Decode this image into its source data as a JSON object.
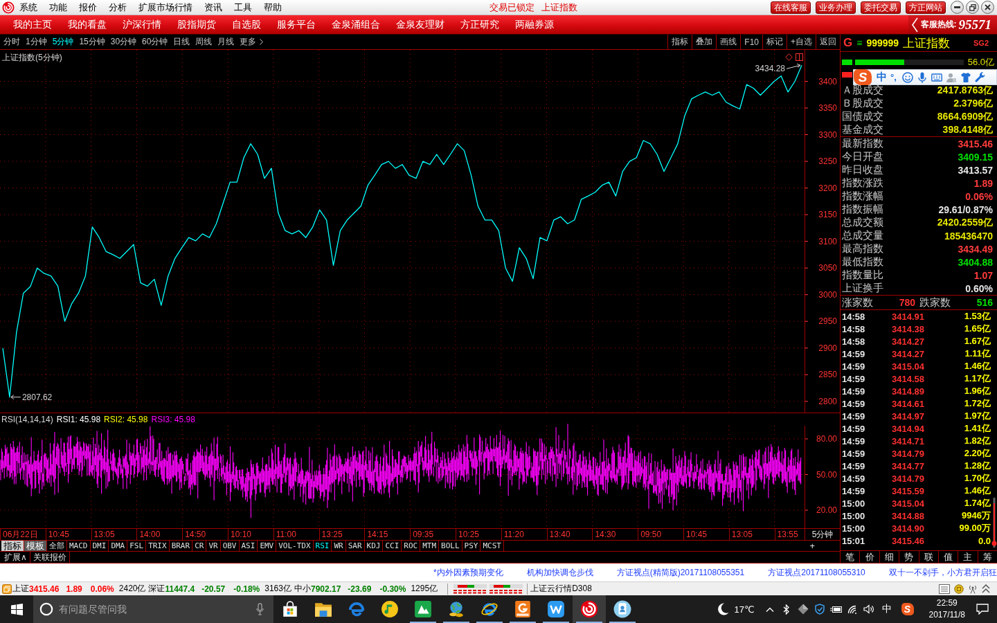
{
  "title_bar": {
    "menu": [
      "系统",
      "功能",
      "报价",
      "分析",
      "扩展市场行情",
      "资讯",
      "工具",
      "帮助"
    ],
    "lock_status": "交易已锁定",
    "current_security": "上证指数",
    "buttons": [
      "在线客服",
      "业务办理",
      "委托交易",
      "方正网站"
    ]
  },
  "nav_bar": {
    "items": [
      "我的主页",
      "我的看盘",
      "沪深行情",
      "股指期货",
      "自选股",
      "服务平台",
      "金泉涌组合",
      "金泉友理财",
      "方正研究",
      "两融券源"
    ],
    "hotline_label": "客服热线:",
    "hotline_number": "95571"
  },
  "chart_toolbar": {
    "periods": [
      {
        "label": "分时",
        "selected": false
      },
      {
        "label": "1分钟",
        "selected": false
      },
      {
        "label": "5分钟",
        "selected": true
      },
      {
        "label": "15分钟",
        "selected": false
      },
      {
        "label": "30分钟",
        "selected": false
      },
      {
        "label": "60分钟",
        "selected": false
      },
      {
        "label": "日线",
        "selected": false
      },
      {
        "label": "周线",
        "selected": false
      },
      {
        "label": "月线",
        "selected": false
      }
    ],
    "more": "更多",
    "tools": [
      "指标",
      "叠加",
      "画线",
      "F10",
      "标记",
      "+自选",
      "返回"
    ]
  },
  "price_chart": {
    "high_label": "3434.28",
    "low_label": "2807.62",
    "chart_data": {
      "type": "line",
      "title": "上证指数(5分钟)",
      "series": [
        {
          "color": "#00ffff",
          "values": [
            2900,
            2808,
            2930,
            3003,
            3015,
            3050,
            3040,
            3035,
            3016,
            2950,
            2983,
            3003,
            3035,
            3127,
            3107,
            3081,
            3075,
            3068,
            3081,
            3094,
            3022,
            3016,
            3029,
            2980,
            3035,
            3068,
            3088,
            3107,
            3101,
            3114,
            3107,
            3133,
            3172,
            3211,
            3211,
            3257,
            3283,
            3263,
            3218,
            3237,
            3153,
            3120,
            3114,
            3120,
            3107,
            3127,
            3159,
            3140,
            3055,
            3120,
            3140,
            3153,
            3166,
            3205,
            3224,
            3244,
            3250,
            3237,
            3244,
            3224,
            3218,
            3250,
            3244,
            3263,
            3244,
            3263,
            3283,
            3270,
            3224,
            3166,
            3140,
            3140,
            3120,
            3050,
            3025,
            3088,
            3068,
            3030,
            3107,
            3101,
            3140,
            3146,
            3133,
            3140,
            3179,
            3185,
            3192,
            3205,
            3211,
            3185,
            3231,
            3250,
            3257,
            3289,
            3283,
            3263,
            3231,
            3257,
            3283,
            3335,
            3367,
            3374,
            3380,
            3374,
            3380,
            3361,
            3354,
            3348,
            3394,
            3387,
            3374,
            3387,
            3400,
            3410,
            3380,
            3400,
            3430
          ]
        }
      ],
      "ylim": [
        2779,
        3459
      ],
      "yticks": [
        2800,
        2850,
        2900,
        2950,
        3000,
        3050,
        3100,
        3150,
        3200,
        3250,
        3300,
        3350,
        3400
      ],
      "grid": true
    }
  },
  "rsi_panel": {
    "title": "RSI(14,14,14)",
    "lines": [
      {
        "label": "RSI1: 45.98",
        "color": "#ffffff"
      },
      {
        "label": "RSI2: 45.98",
        "color": "#ffff00"
      },
      {
        "label": "RSI3: 45.98",
        "color": "#ff00ff"
      }
    ],
    "axis_labels": [
      "80.00",
      "50.00",
      "20.00"
    ]
  },
  "time_axis": {
    "labels": [
      "06月22日",
      "10:45",
      "13:05",
      "14:00",
      "14:50",
      "10:10",
      "11:00",
      "13:25",
      "14:15",
      "09:35",
      "10:25",
      "11:20",
      "13:40",
      "14:30",
      "09:50",
      "10:45",
      "13:05",
      "13:55"
    ],
    "period_label": "5分钟"
  },
  "indicator_bar": {
    "modes": [
      {
        "label": "指标",
        "selected": true
      },
      {
        "label": "模板",
        "selected": false
      }
    ],
    "indicators": [
      {
        "label": "全部",
        "selected": false
      },
      {
        "label": "MACD",
        "selected": false
      },
      {
        "label": "DMI",
        "selected": false
      },
      {
        "label": "DMA",
        "selected": false
      },
      {
        "label": "FSL",
        "selected": false
      },
      {
        "label": "TRIX",
        "selected": false
      },
      {
        "label": "BRAR",
        "selected": false
      },
      {
        "label": "CR",
        "selected": false
      },
      {
        "label": "VR",
        "selected": false
      },
      {
        "label": "OBV",
        "selected": false
      },
      {
        "label": "ASI",
        "selected": false
      },
      {
        "label": "EMV",
        "selected": false
      },
      {
        "label": "VOL-TDX",
        "selected": false
      },
      {
        "label": "RSI",
        "selected": true
      },
      {
        "label": "WR",
        "selected": false
      },
      {
        "label": "SAR",
        "selected": false
      },
      {
        "label": "KDJ",
        "selected": false
      },
      {
        "label": "CCI",
        "selected": false
      },
      {
        "label": "ROC",
        "selected": false
      },
      {
        "label": "MTM",
        "selected": false
      },
      {
        "label": "BOLL",
        "selected": false
      },
      {
        "label": "PSY",
        "selected": false
      },
      {
        "label": "MCST",
        "selected": false
      }
    ],
    "add_label": "+"
  },
  "extra_row": [
    "扩展∧",
    "关联报价"
  ],
  "quote_panel": {
    "flag": "G",
    "menu": "≡",
    "code": "999999",
    "name": "上证指数",
    "tag": "SG2",
    "volume_bars": [
      {
        "color": "#00e000",
        "level": 0.45,
        "reading": "56.0亿"
      },
      {
        "color": "#ff2020"
      }
    ],
    "turnover": [
      {
        "label": "Ａ股成交",
        "value": "2417.8763亿"
      },
      {
        "label": "Ｂ股成交",
        "value": "2.3796亿"
      },
      {
        "label": "国债成交",
        "value": "8664.6909亿"
      },
      {
        "label": "基金成交",
        "value": "398.4148亿"
      }
    ],
    "stats": [
      {
        "label": "最新指数",
        "value": "3415.46",
        "color": "#ff3c3c"
      },
      {
        "label": "今日开盘",
        "value": "3409.15",
        "color": "#00e000"
      },
      {
        "label": "昨日收盘",
        "value": "3413.57",
        "color": "#e8e8e8"
      },
      {
        "label": "指数涨跌",
        "value": "1.89",
        "color": "#ff3c3c"
      },
      {
        "label": "指数涨幅",
        "value": "0.06%",
        "color": "#ff3c3c"
      },
      {
        "label": "指数振幅",
        "value": "29.61/0.87%",
        "color": "#e8e8e8"
      },
      {
        "label": "总成交额",
        "value": "2420.2559亿",
        "color": "#e8e800"
      },
      {
        "label": "总成交量",
        "value": "185436470",
        "color": "#e8e800"
      },
      {
        "label": "最高指数",
        "value": "3434.49",
        "color": "#ff3c3c"
      },
      {
        "label": "最低指数",
        "value": "3404.88",
        "color": "#00e000"
      },
      {
        "label": "指数量比",
        "value": "1.07",
        "color": "#ff3c3c"
      },
      {
        "label": "上证换手",
        "value": "0.60%",
        "color": "#e8e8e8"
      }
    ],
    "breadth": {
      "rising_label": "涨家数",
      "rising": "780",
      "falling_label": "跌家数",
      "falling": "516"
    },
    "ticks": [
      {
        "time": "14:58",
        "price": "3414.91",
        "volume": "1.53亿"
      },
      {
        "time": "14:58",
        "price": "3414.38",
        "volume": "1.65亿"
      },
      {
        "time": "14:58",
        "price": "3414.27",
        "volume": "1.67亿"
      },
      {
        "time": "14:59",
        "price": "3414.27",
        "volume": "1.11亿"
      },
      {
        "time": "14:59",
        "price": "3415.04",
        "volume": "1.46亿"
      },
      {
        "time": "14:59",
        "price": "3414.58",
        "volume": "1.17亿"
      },
      {
        "time": "14:59",
        "price": "3414.89",
        "volume": "1.96亿"
      },
      {
        "time": "14:59",
        "price": "3414.61",
        "volume": "1.72亿"
      },
      {
        "time": "14:59",
        "price": "3414.97",
        "volume": "1.97亿"
      },
      {
        "time": "14:59",
        "price": "3414.94",
        "volume": "1.41亿"
      },
      {
        "time": "14:59",
        "price": "3414.71",
        "volume": "1.82亿"
      },
      {
        "time": "14:59",
        "price": "3414.79",
        "volume": "2.20亿"
      },
      {
        "time": "14:59",
        "price": "3414.77",
        "volume": "1.28亿"
      },
      {
        "time": "14:59",
        "price": "3414.79",
        "volume": "1.70亿"
      },
      {
        "time": "14:59",
        "price": "3415.59",
        "volume": "1.46亿"
      },
      {
        "time": "15:00",
        "price": "3415.04",
        "volume": "1.74亿"
      },
      {
        "time": "15:00",
        "price": "3414.88",
        "volume": "9946万"
      },
      {
        "time": "15:00",
        "price": "3414.90",
        "volume": "99.00万"
      },
      {
        "time": "15:01",
        "price": "3415.46",
        "volume": "0.0"
      }
    ],
    "tabs": [
      "笔",
      "价",
      "细",
      "势",
      "联",
      "值",
      "主",
      "筹"
    ]
  },
  "news_ticker": [
    "*内外因素预期变化",
    "机构加快调仓步伐",
    "方证视点(精简版)20171108055351",
    "方证视点20171108055310",
    "双十一不剁手，小方君开启狂"
  ],
  "status_bar": {
    "indices": [
      {
        "name": "上证",
        "value": "3415.46",
        "change": "1.89",
        "percent": "0.06%",
        "amount": "2420亿",
        "color": "#ff0000"
      },
      {
        "name": "深证",
        "value": "11447.4",
        "change": "-20.57",
        "percent": "-0.18%",
        "amount": "3163亿",
        "color": "#008000"
      },
      {
        "name": "中小",
        "value": "7902.17",
        "change": "-23.69",
        "percent": "-0.30%",
        "amount": "1295亿",
        "color": "#008000"
      }
    ],
    "service": "上证云行情D308"
  },
  "taskbar": {
    "search": {
      "placeholder": "有问题尽管问我"
    },
    "apps": [
      {
        "kind": "bag",
        "running": false,
        "selected": false
      },
      {
        "kind": "folder",
        "running": false,
        "selected": false
      },
      {
        "kind": "browser",
        "running": false,
        "selected": false
      },
      {
        "kind": "disc",
        "running": false,
        "selected": false
      },
      {
        "kind": "tile",
        "running": true,
        "selected": false
      },
      {
        "kind": "globe",
        "running": true,
        "selected": false
      },
      {
        "kind": "browser_ring",
        "running": true,
        "selected": false
      },
      {
        "kind": "pdf",
        "running": true,
        "selected": false
      },
      {
        "kind": "writer",
        "running": true,
        "selected": false
      },
      {
        "kind": "swirl",
        "running": true,
        "selected": true
      },
      {
        "kind": "card",
        "running": true,
        "selected": false
      }
    ],
    "temperature": "17℃",
    "input_mode": "中",
    "ime_logo": "S",
    "time": "22:59",
    "date": "2017/11/8"
  },
  "ime_toolbar": {
    "logo": "S",
    "mode": "中",
    "punctuation": "°,"
  }
}
